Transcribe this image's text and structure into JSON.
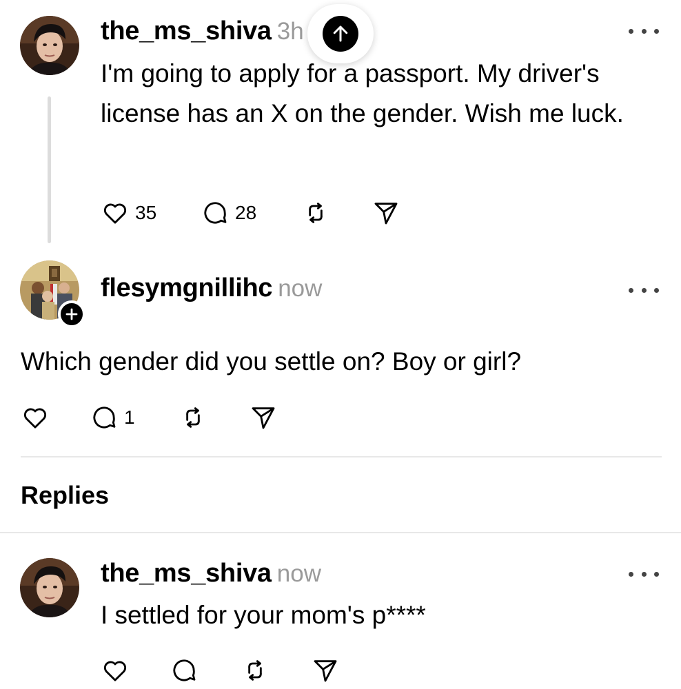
{
  "original_post": {
    "username": "the_ms_shiva",
    "time": "3h",
    "text": "I'm going to apply for a passport. My driver's license has an X on the gender. Wish me luck.",
    "likes": "35",
    "comments": "28",
    "avatar_icon": "avatar-photo"
  },
  "reply_post": {
    "username": "flesymgnillihc",
    "time": "now",
    "text": "Which gender did you settle on? Boy or girl?",
    "comments": "1",
    "avatar_icon": "avatar-photo"
  },
  "replies_header": "Replies",
  "reply_comment": {
    "username": "the_ms_shiva",
    "time": "now",
    "text": "I settled for your mom's p****"
  },
  "icons": {
    "like": "heart-icon",
    "comment": "comment-icon",
    "repost": "repost-icon",
    "share": "share-icon",
    "more": "more-icon",
    "scroll_top": "arrow-up-icon",
    "follow": "plus-icon"
  },
  "colors": {
    "text": "#000000",
    "muted": "#9a9a9a",
    "divider": "#e8e8e8",
    "thread_line": "#dcdcdc"
  }
}
